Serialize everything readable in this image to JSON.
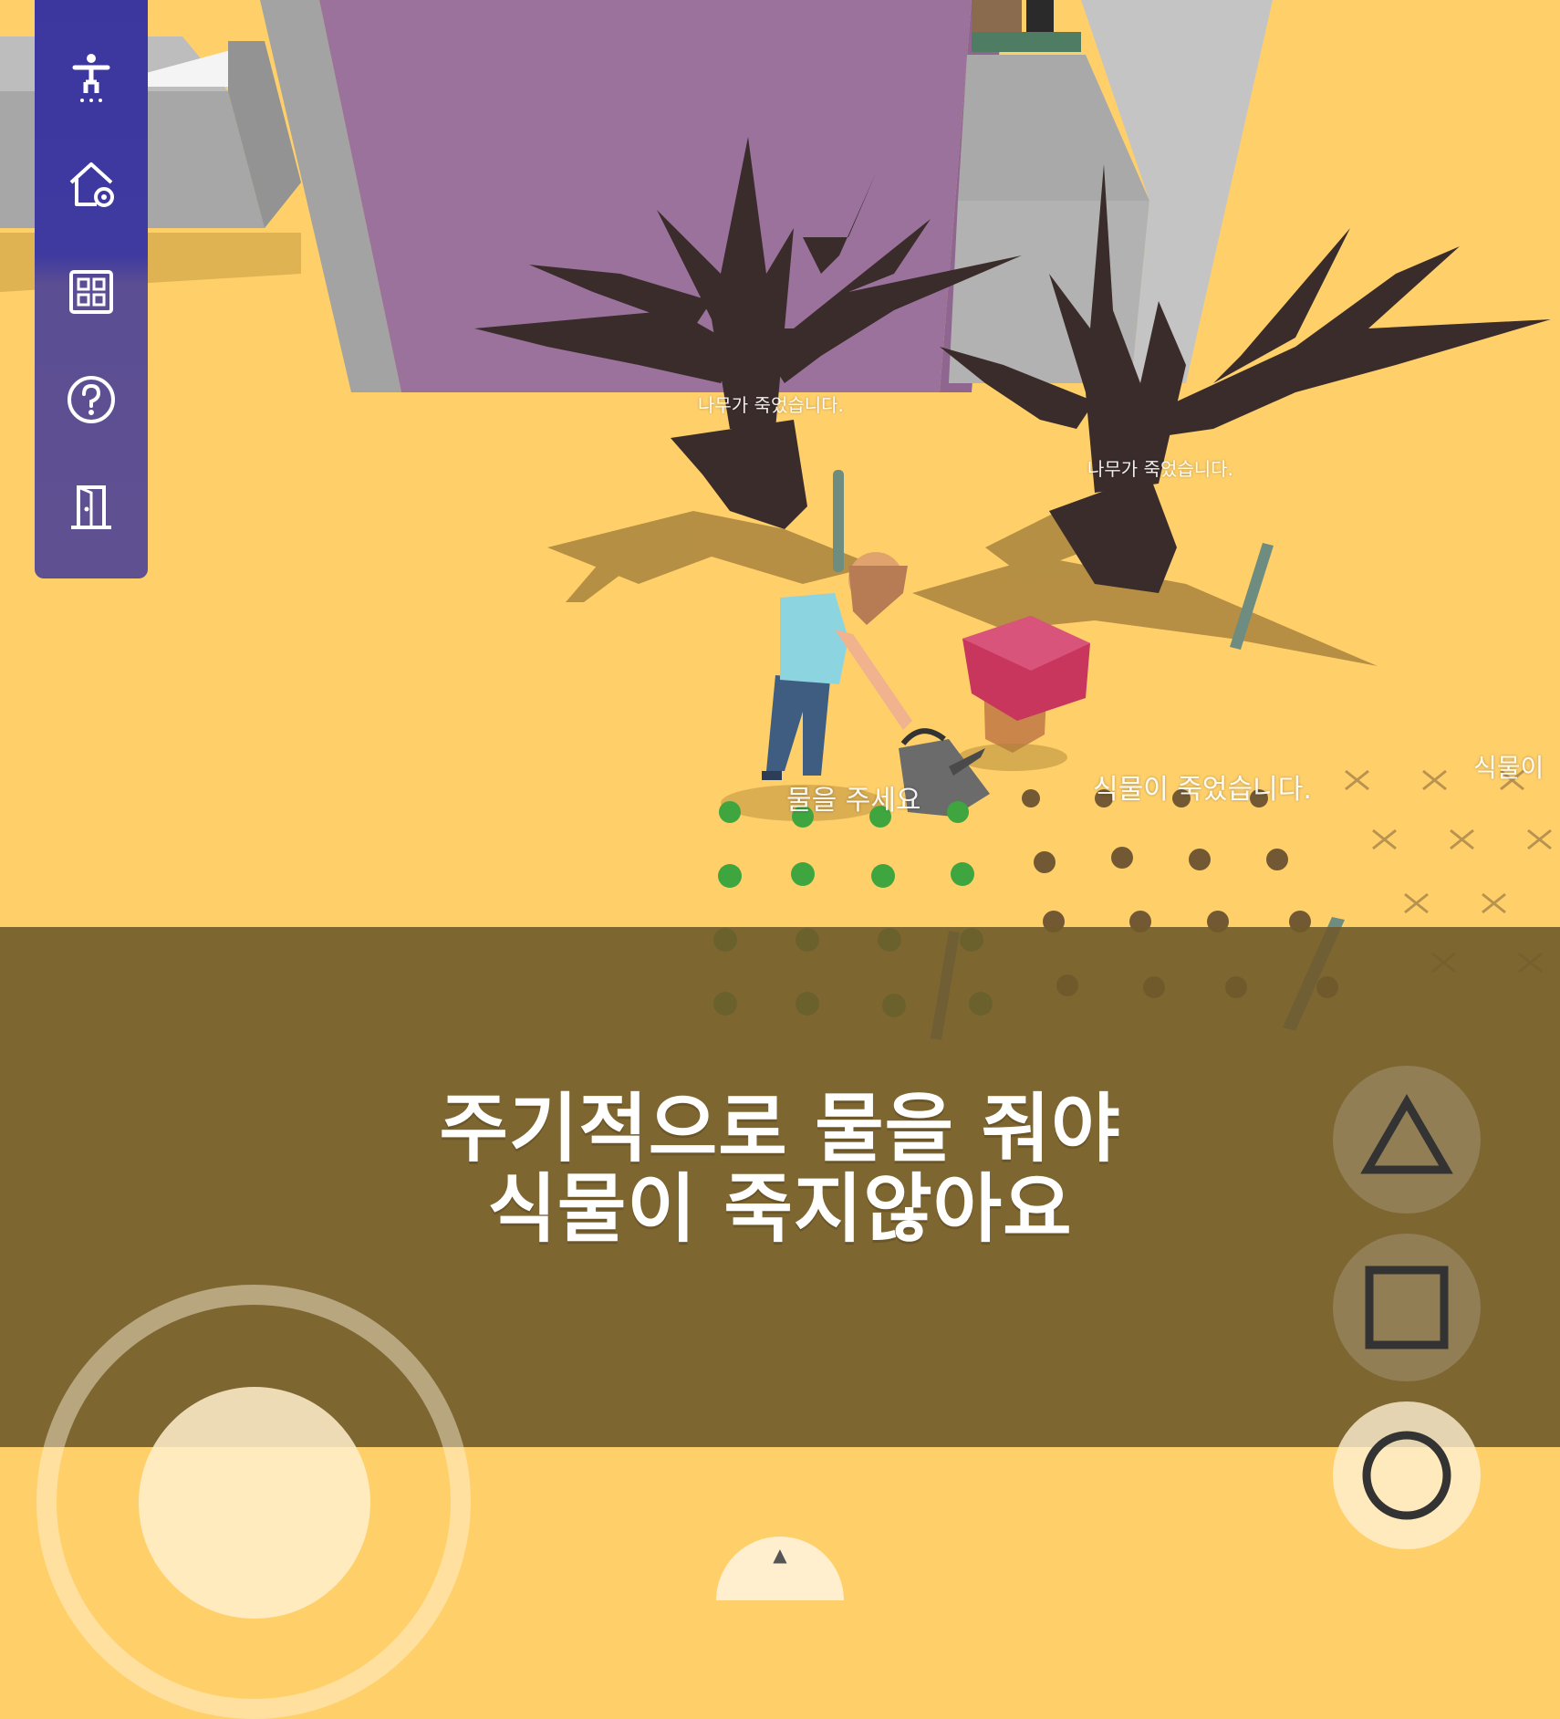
{
  "sidebar": {
    "items": [
      {
        "name": "character",
        "icon": "person-icon"
      },
      {
        "name": "house",
        "icon": "house-gear-icon"
      },
      {
        "name": "grid",
        "icon": "grid-icon"
      },
      {
        "name": "help",
        "icon": "help-icon"
      },
      {
        "name": "exit",
        "icon": "door-icon"
      }
    ],
    "colors": {
      "top": "#3B379F",
      "bottom": "#5E5091"
    }
  },
  "world_labels": {
    "tree_dead_1": "나무가 죽었습니다.",
    "tree_dead_2": "나무가 죽었습니다.",
    "water_please": "물을 주세요",
    "plant_dead": "식물이 죽었습니다.",
    "plant_dead_partial": "식물이"
  },
  "banner": {
    "line1": "주기적으로 물을 줘야",
    "line2": "식물이 죽지않아요",
    "color": "#705A2B"
  },
  "controls": {
    "triangle": "triangle-icon",
    "square": "square-icon",
    "circle": "circle-icon"
  },
  "colors": {
    "ground": "#FFD06A",
    "wall_purple": "#9B729C",
    "wall_gray": "#A6A6A6",
    "tree": "#3A2C2A",
    "mushroom": "#C8365E"
  }
}
